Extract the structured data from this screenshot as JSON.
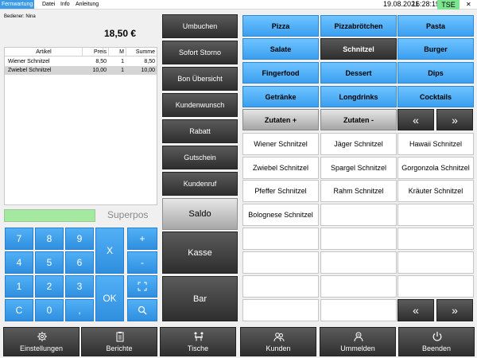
{
  "menu": {
    "items": [
      "Fernwartung",
      "Datei",
      "Info",
      "Anleitung"
    ],
    "date": "19.08.2021",
    "time": "16:28:19",
    "tse": "TSE",
    "close": "✕"
  },
  "order": {
    "bediener_label": "Bediener:",
    "bediener_name": "Nina",
    "total": "18,50 €",
    "columns": [
      "Artikel",
      "Preis",
      "M",
      "Summe"
    ],
    "rows": [
      {
        "artikel": "Wiener Schnitzel",
        "preis": "8,50",
        "menge": "1",
        "summe": "8,50"
      },
      {
        "artikel": "Zwiebel Schnitzel",
        "preis": "10,00",
        "menge": "1",
        "summe": "10,00"
      }
    ]
  },
  "brand": "Superpos",
  "keypad": {
    "digits": [
      "7",
      "8",
      "9",
      "4",
      "5",
      "6",
      "1",
      "2",
      "3",
      "C",
      "0",
      ","
    ],
    "x": "X",
    "ok": "OK",
    "plus": "+",
    "minus": "-"
  },
  "actions": [
    "Umbuchen",
    "Sofort Storno",
    "Bon Übersicht",
    "Kundenwunsch",
    "Rabatt",
    "Gutschein",
    "Kundenruf"
  ],
  "payment": {
    "saldo": "Saldo",
    "kasse": "Kasse",
    "bar": "Bar"
  },
  "categories": [
    "Pizza",
    "Pizzabrötchen",
    "Pasta",
    "Salate",
    "Schnitzel",
    "Burger",
    "Fingerfood",
    "Dessert",
    "Dips",
    "Getränke",
    "Longdrinks",
    "Cocktails"
  ],
  "active_category": "Schnitzel",
  "zutaten": {
    "plus": "Zutaten +",
    "minus": "Zutaten -"
  },
  "nav": {
    "prev": "«",
    "next": "»"
  },
  "products": [
    "Wiener Schnitzel",
    "Jäger Schnitzel",
    "Hawaii Schnitzel",
    "Zwiebel Schnitzel",
    "Spargel Schnitzel",
    "Gorgonzola Schnitzel",
    "Pfeffer Schnitzel",
    "Rahm Schnitzel",
    "Kräuter Schnitzel",
    "Bolognese Schnitzel"
  ],
  "bottom_bar": [
    {
      "label": "Einstellungen",
      "icon": "gear-icon"
    },
    {
      "label": "Berichte",
      "icon": "clipboard-icon"
    },
    {
      "label": "Tische",
      "icon": "table-icon"
    },
    {
      "label": "Kunden",
      "icon": "users-icon"
    },
    {
      "label": "Ummelden",
      "icon": "user-switch-icon"
    },
    {
      "label": "Beenden",
      "icon": "power-icon"
    }
  ],
  "colors": {
    "accent_blue": "#3a9ff0",
    "dark_button": "#2e2e2e",
    "tse_green": "#7de58f"
  }
}
